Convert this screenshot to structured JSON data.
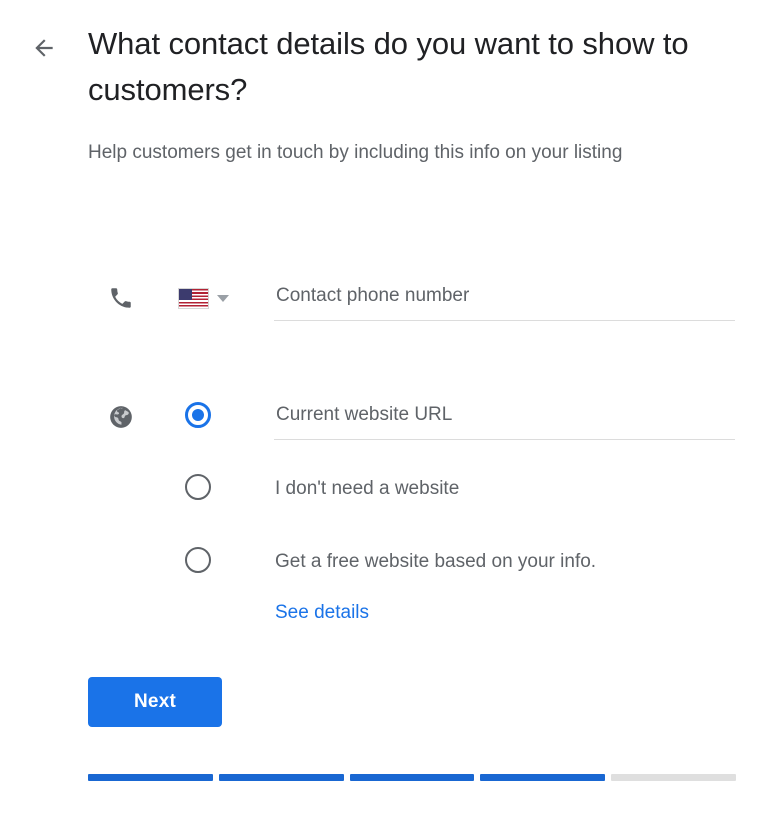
{
  "header": {
    "back_icon": "arrow-left-icon",
    "title": "What contact details do you want to show to customers?",
    "subtitle": "Help customers get in touch by including this info on your listing"
  },
  "form": {
    "phone": {
      "icon": "phone-icon",
      "country_flag": "us-flag-icon",
      "country_caret": "chevron-down-icon",
      "placeholder": "Contact phone number",
      "value": ""
    },
    "website": {
      "icon": "globe-icon",
      "options": [
        {
          "id": "current-website",
          "type": "input",
          "selected": true,
          "placeholder": "Current website URL",
          "value": ""
        },
        {
          "id": "no-website",
          "type": "label",
          "selected": false,
          "label": "I don't need a website"
        },
        {
          "id": "free-website",
          "type": "label",
          "selected": false,
          "label": "Get a free website based on your info."
        }
      ],
      "see_details_link": "See details"
    }
  },
  "actions": {
    "next_label": "Next"
  },
  "progress": {
    "total_steps": 5,
    "completed_steps": 4,
    "segments": [
      true,
      true,
      true,
      true,
      false
    ]
  },
  "colors": {
    "accent": "#1a73e8",
    "progress_filled": "#1967d2",
    "progress_empty": "#dfdfdf",
    "text_primary": "#202124",
    "text_secondary": "#5f6368"
  }
}
